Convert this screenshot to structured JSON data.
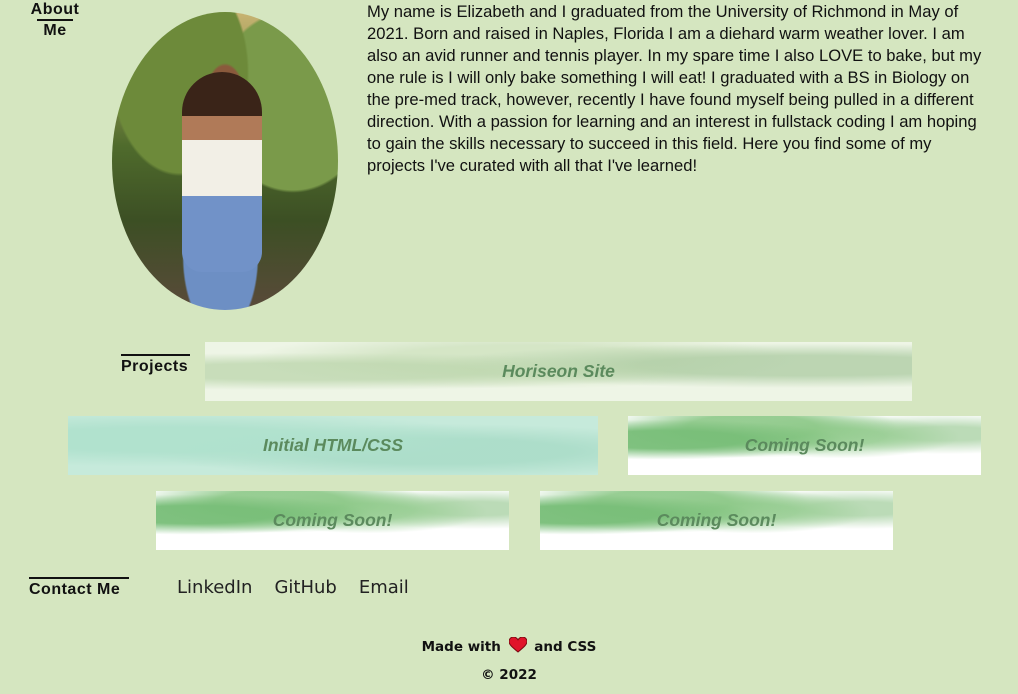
{
  "about": {
    "heading_line1": "About",
    "heading_line2": "Me",
    "bio": "My name is Elizabeth and I graduated from the University of Richmond in May of 2021. Born and raised in Naples, Florida I am a diehard warm weather lover. I am also an avid runner and tennis player. In my spare time I also LOVE to bake, but my one rule is I will only bake something I will eat! I graduated with a BS in Biology on the pre-med track, however, recently I have found myself being pulled in a different direction. With a passion for learning and an interest in fullstack coding I am hoping to gain the skills necessary to succeed in this field. Here you find some of my projects I've curated with all that I've learned!"
  },
  "projects": {
    "heading": "Projects",
    "items": [
      {
        "label": "Horiseon Site"
      },
      {
        "label": "Initial HTML/CSS"
      },
      {
        "label": "Coming Soon!"
      },
      {
        "label": "Coming Soon!"
      },
      {
        "label": "Coming Soon!"
      }
    ]
  },
  "contact": {
    "heading": "Contact Me",
    "links": [
      "LinkedIn",
      "GitHub",
      "Email"
    ]
  },
  "footer": {
    "made_with_before": "Made with",
    "made_with_after": "and CSS",
    "copyright": "© 2022",
    "heart_icon": "heart-icon"
  },
  "colors": {
    "background": "#d5e6c0",
    "card_text": "#5b8a5d",
    "heart": "#e0142a"
  }
}
